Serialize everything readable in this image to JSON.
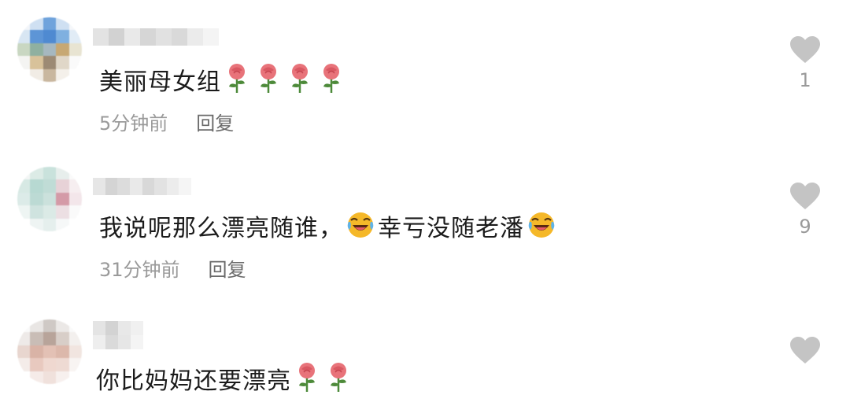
{
  "comments": [
    {
      "text_before": "美丽母女组",
      "emojis_before": [
        "rose",
        "rose",
        "rose",
        "rose"
      ],
      "text_after": "",
      "emojis_after": [],
      "time": "5分钟前",
      "reply_label": "回复",
      "like_count": "1",
      "like_icon": "heart-icon"
    },
    {
      "text_before": "我说呢那么漂亮随谁，",
      "emojis_mid": [
        "laugh-cry"
      ],
      "text_after": "幸亏没随老潘",
      "emojis_after": [
        "laugh-cry"
      ],
      "time": "31分钟前",
      "reply_label": "回复",
      "like_count": "9",
      "like_icon": "heart-icon"
    },
    {
      "text_before": "你比妈妈还要漂亮",
      "emojis_after": [
        "rose",
        "rose"
      ],
      "time": "",
      "reply_label": "",
      "like_count": "",
      "like_icon": "heart-icon"
    }
  ],
  "colors": {
    "heart": "#c4c4c4",
    "meta_text": "#9a9a9a",
    "body_text": "#1b1b1b",
    "rose_petal": "#e8737a",
    "rose_leaf": "#4d8a3a",
    "laugh_face": "#f5b829"
  }
}
